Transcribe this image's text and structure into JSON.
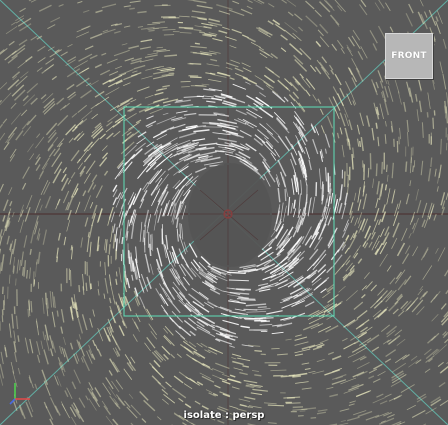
{
  "viewport": {
    "view_cube_label": "FRONT",
    "camera_label": "isolate : persp",
    "colors": {
      "background": "#5a5a5a",
      "hair": "#f1f0c4",
      "resolution_gate": "#5fe0b8",
      "guide_lines": "#63bdb0",
      "grid_axis": "#4a2a2a"
    }
  },
  "axis_gizmo": {
    "icons": [
      "x-axis-icon",
      "y-axis-icon",
      "z-axis-icon"
    ]
  }
}
